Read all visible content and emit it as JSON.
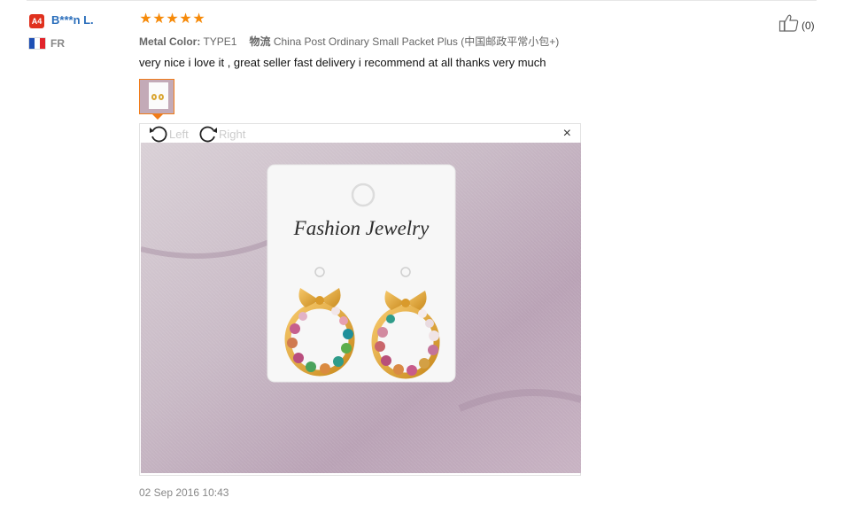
{
  "reviewer": {
    "level_badge": "A4",
    "name": "B***n L.",
    "country": "FR",
    "flag_colors": [
      "#1f4fb4",
      "#ffffff",
      "#e2242b"
    ]
  },
  "review": {
    "rating": 5,
    "stars": [
      "★",
      "★",
      "★",
      "★",
      "★"
    ],
    "star_color": "#f68a0a",
    "attributes": [
      {
        "label": "Metal Color:",
        "value": "TYPE1"
      },
      {
        "label": "物流",
        "value": "China Post Ordinary Small Packet Plus (中国邮政平常小包+)"
      }
    ],
    "text": "very nice i love it , great seller fast delivery i recommend at all thanks very much",
    "date": "02 Sep 2016 10:43"
  },
  "viewer": {
    "rotate_left_label": "Left",
    "rotate_right_label": "Right",
    "close_symbol": "×",
    "photo": {
      "card_text": "Fashion Jewelry"
    }
  },
  "helpful": {
    "count": "(0)"
  },
  "colors": {
    "accent_orange": "#f07c1a",
    "link_blue": "#2a6ebb",
    "badge_red": "#e0311e"
  }
}
